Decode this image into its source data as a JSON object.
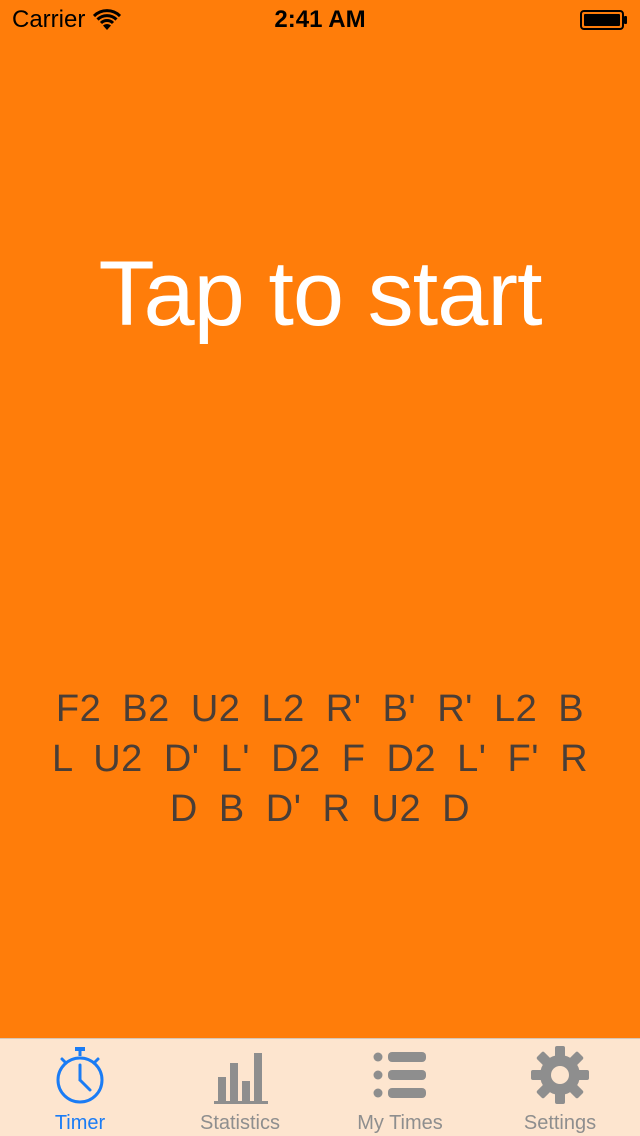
{
  "status_bar": {
    "carrier": "Carrier",
    "time": "2:41 AM"
  },
  "main": {
    "prompt": "Tap to start",
    "scramble": "F2 B2 U2 L2 R' B' R' L2 B L U2 D' L' D2 F D2 L' F' R D B D' R U2 D"
  },
  "tab_bar": {
    "tabs": [
      {
        "label": "Timer",
        "icon": "stopwatch-icon",
        "active": true
      },
      {
        "label": "Statistics",
        "icon": "bar-chart-icon",
        "active": false
      },
      {
        "label": "My Times",
        "icon": "list-icon",
        "active": false
      },
      {
        "label": "Settings",
        "icon": "gear-icon",
        "active": false
      }
    ]
  },
  "colors": {
    "background": "#FF7D0A",
    "prompt_text": "#FFFFFF",
    "scramble_text": "#4A3E37",
    "tab_bar_background": "#FDE5CF",
    "tab_active": "#1A7CF5",
    "tab_inactive": "#8E8E8E"
  }
}
